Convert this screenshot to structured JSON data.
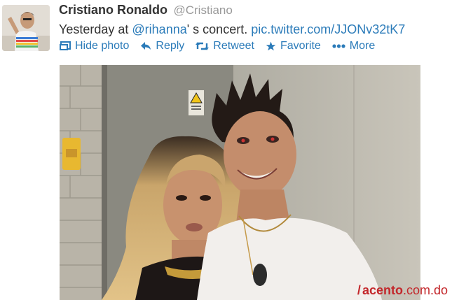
{
  "tweet": {
    "display_name": "Cristiano Ronaldo",
    "handle": "@Cristiano",
    "text_prefix": "Yesterday at ",
    "mention": "@rihanna",
    "text_middle": "' s concert. ",
    "link": "pic.twitter.com/JJONv32tK7"
  },
  "actions": {
    "hide_photo": "Hide photo",
    "reply": "Reply",
    "retweet": "Retweet",
    "favorite": "Favorite",
    "more": "More"
  },
  "watermark": {
    "brand": "acento",
    "domain": ".com.do"
  },
  "colors": {
    "link": "#2b7bb9",
    "watermark": "#c3272b"
  },
  "icons": {
    "hide_photo": "photo-icon",
    "reply": "reply-icon",
    "retweet": "retweet-icon",
    "favorite": "star-icon",
    "more": "ellipsis-icon"
  }
}
